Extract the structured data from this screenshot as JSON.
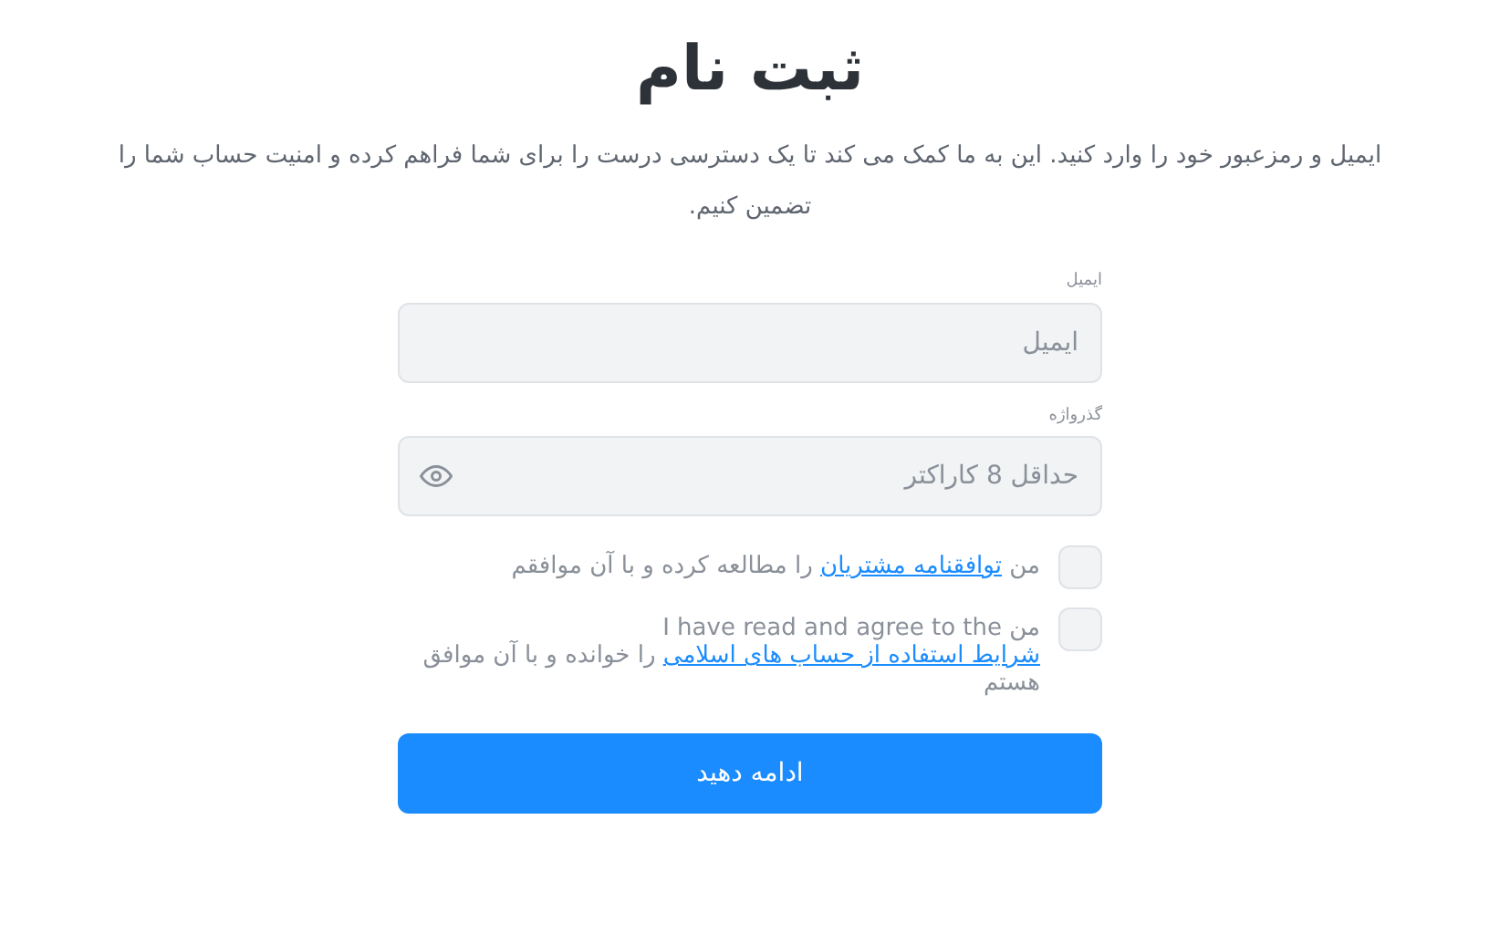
{
  "title": "ثبت نام",
  "description": "ایمیل و رمزعبور خود را وارد کنید. این به ما کمک می کند تا یک دسترسی درست را برای شما فراهم کرده و امنیت حساب شما را تضمین کنیم.",
  "fields": [
    {
      "label": "ایمیل",
      "placeholder": "ایمیل",
      "kind": "text"
    },
    {
      "label": "گذرواژه",
      "placeholder": "حداقل 8 کاراکتر",
      "kind": "password"
    }
  ],
  "agreements": [
    {
      "checked": false,
      "before": "من ",
      "link": "توافقنامه مشتریان",
      "after": " را مطالعه کرده و با آن موافقم"
    },
    {
      "checked": false,
      "before": "من I have read and agree to the ",
      "link": "شرایط استفاده از حساب های اسلامی",
      "after": " را خوانده و با آن موافق هستم"
    }
  ],
  "submit": "ادامه دهید"
}
